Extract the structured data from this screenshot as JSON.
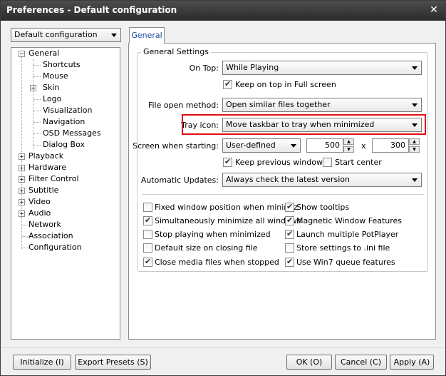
{
  "window": {
    "title": "Preferences - Default configuration",
    "close_glyph": "✕"
  },
  "config_selector": {
    "value": "Default configuration"
  },
  "tree": {
    "general": "General",
    "general_children": [
      "Shortcuts",
      "Mouse",
      "Skin",
      "Logo",
      "Visualization",
      "Navigation",
      "OSD Messages",
      "Dialog Box"
    ],
    "top_items": [
      "Playback",
      "Hardware",
      "Filter Control",
      "Subtitle",
      "Video",
      "Audio",
      "Network",
      "Association",
      "Configuration"
    ]
  },
  "tabs": {
    "general": "General"
  },
  "general_settings": {
    "group_label": "General Settings",
    "on_top_label": "On Top:",
    "on_top_value": "While Playing",
    "keep_on_top_fullscreen": "Keep on top in Full screen",
    "file_open_label": "File open method:",
    "file_open_value": "Open similar files together",
    "tray_icon_label": "Tray icon:",
    "tray_icon_value": "Move taskbar to tray when minimized",
    "screen_starting_label": "Screen when starting:",
    "screen_starting_value": "User-defined",
    "width_value": "500",
    "times": "x",
    "height_value": "300",
    "keep_previous_window": "Keep previous window",
    "start_center": "Start center",
    "auto_updates_label": "Automatic Updates:",
    "auto_updates_value": "Always check the latest version"
  },
  "checkboxes_left": [
    {
      "label": "Fixed window position when minimiz",
      "checked": false
    },
    {
      "label": "Simultaneously minimize all windows",
      "checked": true
    },
    {
      "label": "Stop playing when minimized",
      "checked": false
    },
    {
      "label": "Default size on closing file",
      "checked": false
    },
    {
      "label": "Close media files when stopped",
      "checked": true
    }
  ],
  "checkboxes_right": [
    {
      "label": "Show tooltips",
      "checked": true
    },
    {
      "label": "Magnetic Window Features",
      "checked": true
    },
    {
      "label": "Launch multiple PotPlayer",
      "checked": true
    },
    {
      "label": "Store settings to .ini file",
      "checked": false
    },
    {
      "label": "Use Win7 queue features",
      "checked": true
    }
  ],
  "buttons": {
    "initialize": "Initialize (I)",
    "export_presets": "Export Presets (S)",
    "ok": "OK (O)",
    "cancel": "Cancel (C)",
    "apply": "Apply (A)"
  },
  "colors": {
    "highlight": "#e01010",
    "tab_text": "#1a4aa0"
  }
}
